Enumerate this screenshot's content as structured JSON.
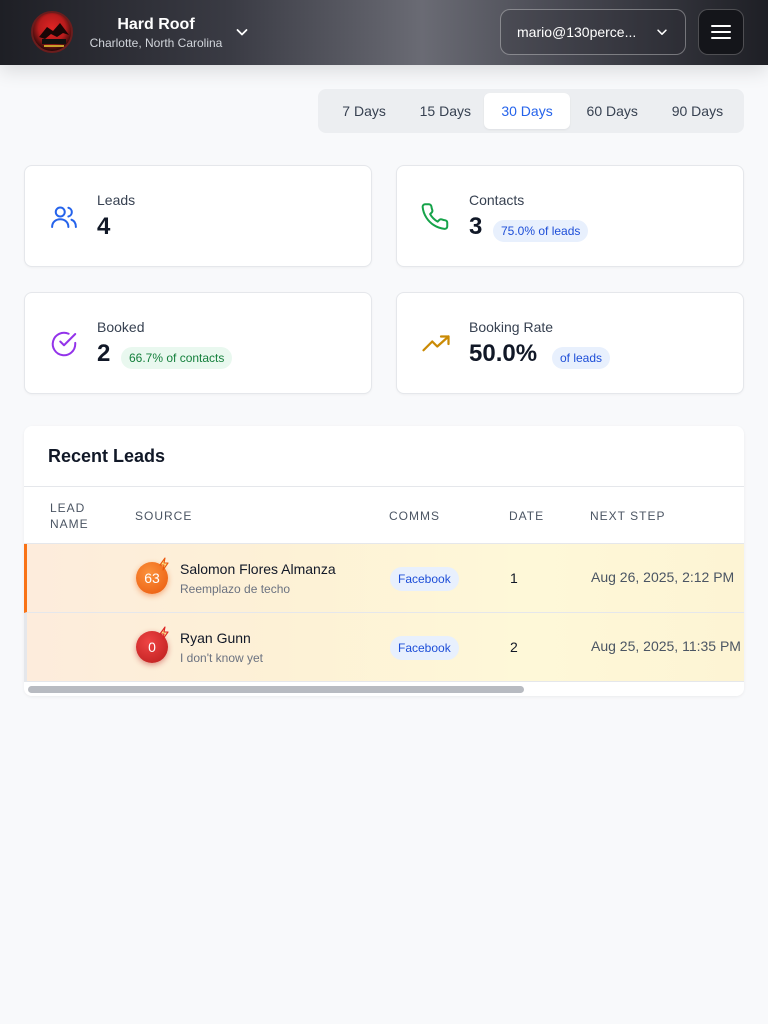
{
  "header": {
    "company_name": "Hard Roof",
    "location": "Charlotte, North Carolina",
    "account_email": "mario@130perce..."
  },
  "range_tabs": [
    {
      "label": "7 Days",
      "active": false
    },
    {
      "label": "15 Days",
      "active": false
    },
    {
      "label": "30 Days",
      "active": true
    },
    {
      "label": "60 Days",
      "active": false
    },
    {
      "label": "90 Days",
      "active": false
    }
  ],
  "stats": {
    "leads": {
      "label": "Leads",
      "value": "4"
    },
    "contacts": {
      "label": "Contacts",
      "value": "3",
      "badge": "75.0% of leads"
    },
    "booked": {
      "label": "Booked",
      "value": "2",
      "badge": "66.7% of contacts"
    },
    "booking_rate": {
      "label": "Booking Rate",
      "value": "50.0%",
      "badge": "of leads"
    }
  },
  "recent_leads": {
    "title": "Recent Leads",
    "columns": [
      "LEAD NAME",
      "SOURCE",
      "COMMS",
      "DATE",
      "NEXT STEP"
    ],
    "rows": [
      {
        "score": "63",
        "name": "Salomon Flores Almanza",
        "subtitle": "Reemplazo de techo",
        "comms": "Facebook",
        "date": "1",
        "next_step": "Aug 26, 2025, 2:12 PM"
      },
      {
        "score": "0",
        "name": "Ryan Gunn",
        "subtitle": "I don't know yet",
        "comms": "Facebook",
        "date": "2",
        "next_step": "Aug 25, 2025, 11:35 PM"
      }
    ]
  },
  "colors": {
    "accent_blue": "#2563eb",
    "hot_orange": "#f97316",
    "score_red": "#dc2626",
    "booked_purple": "#9333ea",
    "contacts_green": "#16a34a",
    "rate_gold": "#ca8a04"
  },
  "icons": {
    "leads": "users-icon",
    "contacts": "phone-icon",
    "booked": "check-circle-icon",
    "booking_rate": "trending-up-icon",
    "menu": "hamburger-menu-icon",
    "hot": "lightning-bolt-icon"
  }
}
